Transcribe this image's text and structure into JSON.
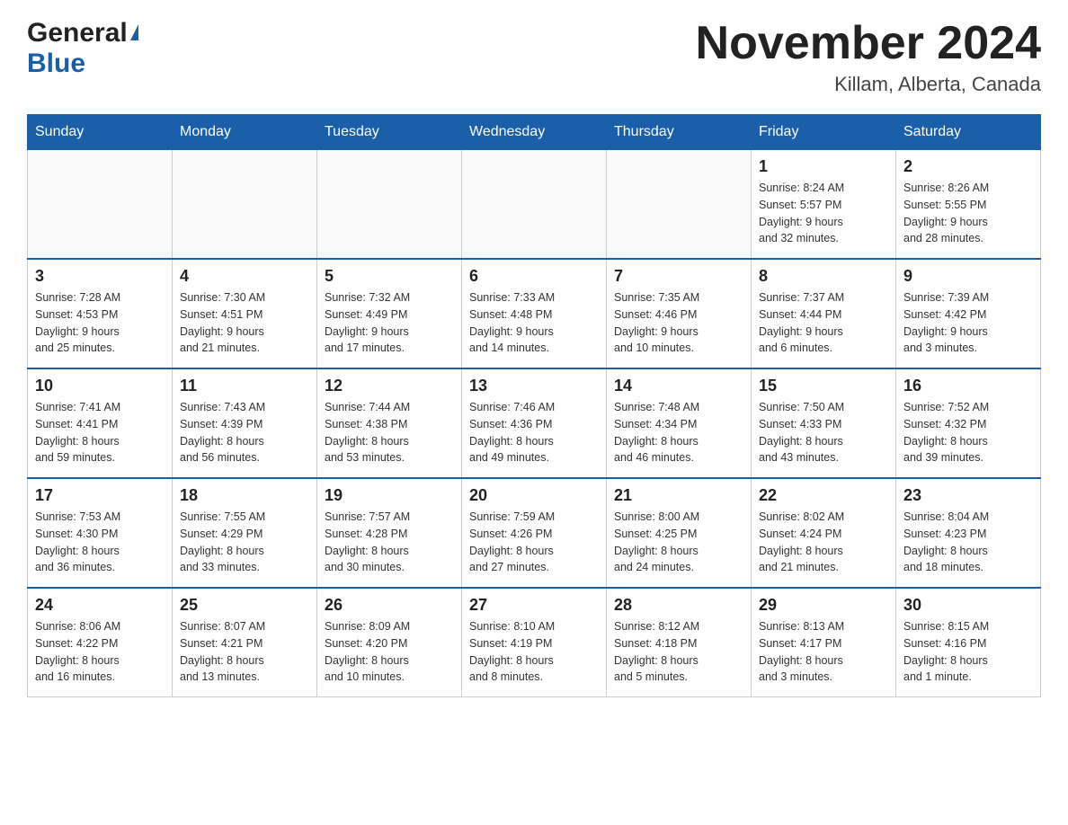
{
  "header": {
    "logo_general": "General",
    "logo_blue": "Blue",
    "month_title": "November 2024",
    "location": "Killam, Alberta, Canada"
  },
  "weekdays": [
    "Sunday",
    "Monday",
    "Tuesday",
    "Wednesday",
    "Thursday",
    "Friday",
    "Saturday"
  ],
  "weeks": [
    [
      {
        "day": "",
        "info": ""
      },
      {
        "day": "",
        "info": ""
      },
      {
        "day": "",
        "info": ""
      },
      {
        "day": "",
        "info": ""
      },
      {
        "day": "",
        "info": ""
      },
      {
        "day": "1",
        "info": "Sunrise: 8:24 AM\nSunset: 5:57 PM\nDaylight: 9 hours\nand 32 minutes."
      },
      {
        "day": "2",
        "info": "Sunrise: 8:26 AM\nSunset: 5:55 PM\nDaylight: 9 hours\nand 28 minutes."
      }
    ],
    [
      {
        "day": "3",
        "info": "Sunrise: 7:28 AM\nSunset: 4:53 PM\nDaylight: 9 hours\nand 25 minutes."
      },
      {
        "day": "4",
        "info": "Sunrise: 7:30 AM\nSunset: 4:51 PM\nDaylight: 9 hours\nand 21 minutes."
      },
      {
        "day": "5",
        "info": "Sunrise: 7:32 AM\nSunset: 4:49 PM\nDaylight: 9 hours\nand 17 minutes."
      },
      {
        "day": "6",
        "info": "Sunrise: 7:33 AM\nSunset: 4:48 PM\nDaylight: 9 hours\nand 14 minutes."
      },
      {
        "day": "7",
        "info": "Sunrise: 7:35 AM\nSunset: 4:46 PM\nDaylight: 9 hours\nand 10 minutes."
      },
      {
        "day": "8",
        "info": "Sunrise: 7:37 AM\nSunset: 4:44 PM\nDaylight: 9 hours\nand 6 minutes."
      },
      {
        "day": "9",
        "info": "Sunrise: 7:39 AM\nSunset: 4:42 PM\nDaylight: 9 hours\nand 3 minutes."
      }
    ],
    [
      {
        "day": "10",
        "info": "Sunrise: 7:41 AM\nSunset: 4:41 PM\nDaylight: 8 hours\nand 59 minutes."
      },
      {
        "day": "11",
        "info": "Sunrise: 7:43 AM\nSunset: 4:39 PM\nDaylight: 8 hours\nand 56 minutes."
      },
      {
        "day": "12",
        "info": "Sunrise: 7:44 AM\nSunset: 4:38 PM\nDaylight: 8 hours\nand 53 minutes."
      },
      {
        "day": "13",
        "info": "Sunrise: 7:46 AM\nSunset: 4:36 PM\nDaylight: 8 hours\nand 49 minutes."
      },
      {
        "day": "14",
        "info": "Sunrise: 7:48 AM\nSunset: 4:34 PM\nDaylight: 8 hours\nand 46 minutes."
      },
      {
        "day": "15",
        "info": "Sunrise: 7:50 AM\nSunset: 4:33 PM\nDaylight: 8 hours\nand 43 minutes."
      },
      {
        "day": "16",
        "info": "Sunrise: 7:52 AM\nSunset: 4:32 PM\nDaylight: 8 hours\nand 39 minutes."
      }
    ],
    [
      {
        "day": "17",
        "info": "Sunrise: 7:53 AM\nSunset: 4:30 PM\nDaylight: 8 hours\nand 36 minutes."
      },
      {
        "day": "18",
        "info": "Sunrise: 7:55 AM\nSunset: 4:29 PM\nDaylight: 8 hours\nand 33 minutes."
      },
      {
        "day": "19",
        "info": "Sunrise: 7:57 AM\nSunset: 4:28 PM\nDaylight: 8 hours\nand 30 minutes."
      },
      {
        "day": "20",
        "info": "Sunrise: 7:59 AM\nSunset: 4:26 PM\nDaylight: 8 hours\nand 27 minutes."
      },
      {
        "day": "21",
        "info": "Sunrise: 8:00 AM\nSunset: 4:25 PM\nDaylight: 8 hours\nand 24 minutes."
      },
      {
        "day": "22",
        "info": "Sunrise: 8:02 AM\nSunset: 4:24 PM\nDaylight: 8 hours\nand 21 minutes."
      },
      {
        "day": "23",
        "info": "Sunrise: 8:04 AM\nSunset: 4:23 PM\nDaylight: 8 hours\nand 18 minutes."
      }
    ],
    [
      {
        "day": "24",
        "info": "Sunrise: 8:06 AM\nSunset: 4:22 PM\nDaylight: 8 hours\nand 16 minutes."
      },
      {
        "day": "25",
        "info": "Sunrise: 8:07 AM\nSunset: 4:21 PM\nDaylight: 8 hours\nand 13 minutes."
      },
      {
        "day": "26",
        "info": "Sunrise: 8:09 AM\nSunset: 4:20 PM\nDaylight: 8 hours\nand 10 minutes."
      },
      {
        "day": "27",
        "info": "Sunrise: 8:10 AM\nSunset: 4:19 PM\nDaylight: 8 hours\nand 8 minutes."
      },
      {
        "day": "28",
        "info": "Sunrise: 8:12 AM\nSunset: 4:18 PM\nDaylight: 8 hours\nand 5 minutes."
      },
      {
        "day": "29",
        "info": "Sunrise: 8:13 AM\nSunset: 4:17 PM\nDaylight: 8 hours\nand 3 minutes."
      },
      {
        "day": "30",
        "info": "Sunrise: 8:15 AM\nSunset: 4:16 PM\nDaylight: 8 hours\nand 1 minute."
      }
    ]
  ]
}
